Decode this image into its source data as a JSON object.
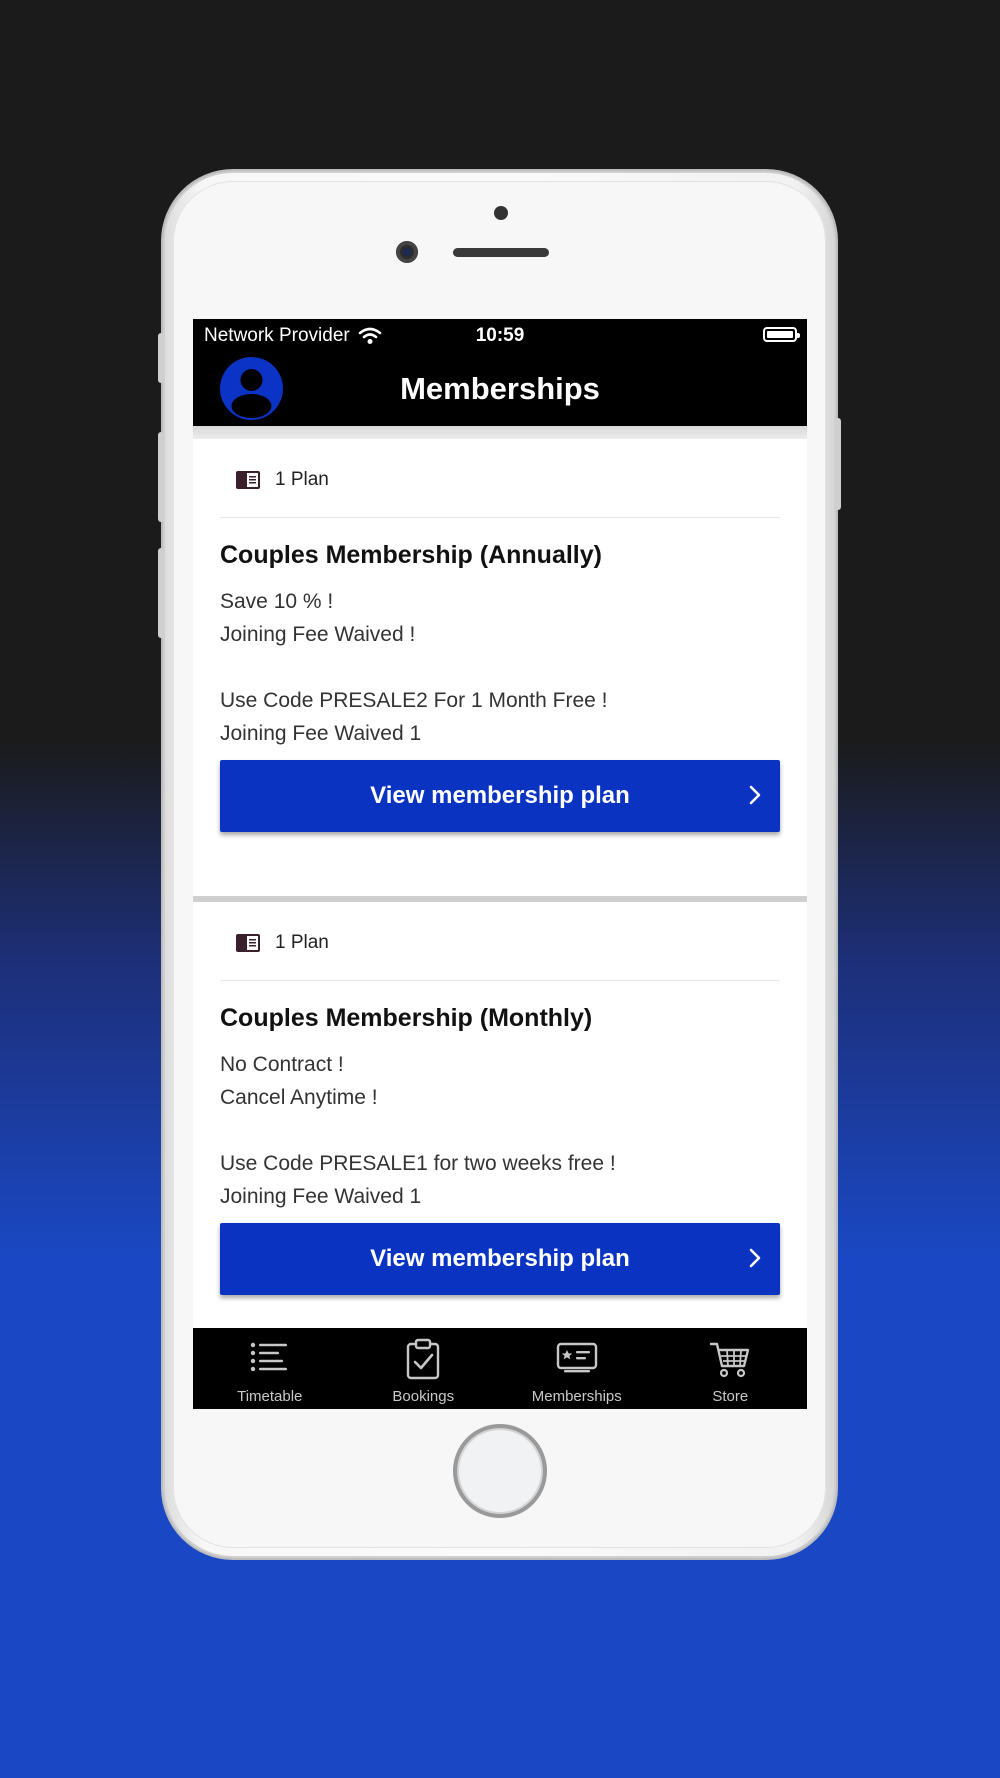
{
  "status_bar": {
    "carrier": "Network Provider",
    "time": "10:59"
  },
  "header": {
    "title": "Memberships"
  },
  "memberships": [
    {
      "plan_count": "1 Plan",
      "title": "Couples Membership (Annually)",
      "description_lines": [
        "Save 10 % !",
        "Joining Fee Waived !",
        "",
        "Use Code PRESALE2 For 1 Month Free !",
        "Joining Fee Waived 1"
      ],
      "button_label": "View membership plan"
    },
    {
      "plan_count": "1 Plan",
      "title": "Couples Membership (Monthly)",
      "description_lines": [
        "No Contract !",
        "Cancel Anytime !",
        "",
        "Use Code PRESALE1 for two weeks free !",
        "Joining Fee Waived 1"
      ],
      "button_label": "View membership plan"
    }
  ],
  "tab_bar": {
    "tabs": [
      {
        "label": "Timetable",
        "icon": "list-icon"
      },
      {
        "label": "Bookings",
        "icon": "clipboard-check-icon"
      },
      {
        "label": "Memberships",
        "icon": "id-card-icon"
      },
      {
        "label": "Store",
        "icon": "cart-icon"
      }
    ]
  },
  "colors": {
    "accent": "#0a33c2",
    "header_bg": "#000000",
    "tab_label": "#c9c9c9"
  }
}
